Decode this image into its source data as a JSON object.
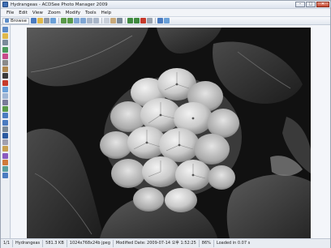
{
  "window": {
    "title": "Hydrangeas - ACDSee Photo Manager 2009"
  },
  "window_controls": {
    "minimize": "–",
    "maximize": "□",
    "close": "✕"
  },
  "menu": [
    "File",
    "Edit",
    "View",
    "Zoom",
    "Modify",
    "Tools",
    "Help"
  ],
  "toolbar": {
    "browse_label": "Browse",
    "icons": [
      "save-icon",
      "open-icon",
      "print-icon",
      "email-icon",
      "rotate-left-icon",
      "rotate-right-icon",
      "zoom-in-icon",
      "zoom-out-icon",
      "fit-icon",
      "actual-size-icon",
      "select-icon",
      "hand-icon",
      "crop-icon",
      "previous-icon",
      "next-icon",
      "delete-icon",
      "close-image-icon",
      "properties-icon",
      "help-icon"
    ]
  },
  "left_tools": [
    "history-icon",
    "exposure-icon",
    "levels-icon",
    "curves-icon",
    "color-balance-icon",
    "grayscale-icon",
    "sepia-icon",
    "negative-icon",
    "red-eye-icon",
    "sharpen-icon",
    "blur-icon",
    "noise-icon",
    "resize-icon",
    "rotate-icon",
    "flip-icon",
    "crop-tool-icon",
    "text-icon",
    "border-icon",
    "vignette-icon",
    "special-fx-icon",
    "draw-icon",
    "clone-icon",
    "edit-icon"
  ],
  "photo": {
    "alt_subject": "Hydrangeas"
  },
  "status": {
    "index": "1/1",
    "name": "Hydrangeas",
    "size": "581.3 KB",
    "dimensions": "1024x768x24b jpeg",
    "modified": "Modified Date: 2009-07-14 오후 1:52:25",
    "zoom": "86%",
    "load_time": "Loaded in 0.07 s"
  },
  "colors": {
    "accent": "#3f6fb5",
    "window_bg": "#eef1f6",
    "photo_bg": "#0e0e0e"
  }
}
